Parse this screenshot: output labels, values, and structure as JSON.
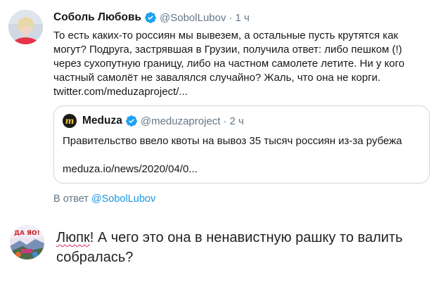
{
  "tweet": {
    "author_name": "Соболь Любовь",
    "handle": "@SobolLubov",
    "separator": "·",
    "time": "1 ч",
    "text_lines": [
      "То есть каких-то россиян мы вывезем, а остальные пусть крутятся как",
      "могут? Подруга, застрявшая в Грузии, получила ответ: либо пешком (!)",
      "через сухопутную границу, либо на частном самолете летите. Ни у кого",
      "частный самолёт не завалялся случайно? Жаль, что она не корги.",
      "twitter.com/meduzaproject/..."
    ],
    "quote": {
      "logo_letter": "m",
      "author_name": "Meduza",
      "handle": "@meduzaproject",
      "separator": "·",
      "time": "2 ч",
      "text": "Правительство ввело квоты на вывоз 35 тысяч россиян из-за рубежа",
      "link": "meduza.io/news/2020/04/0..."
    },
    "reply_prefix": "В ответ",
    "reply_mention": "@SobolLubov"
  },
  "comment": {
    "first_word": "Люпк",
    "line1_rest": "! А чего это она в ненавистную рашку то валить",
    "line2": "собралась?"
  },
  "colors": {
    "verified_blue": "#1da1f2",
    "link_blue": "#1b95e0",
    "muted_gray": "#657786",
    "border_gray": "#ccd6dd"
  },
  "icons": {
    "verified": "verified-badge-icon",
    "meduza_logo": "meduza-logo-icon"
  }
}
